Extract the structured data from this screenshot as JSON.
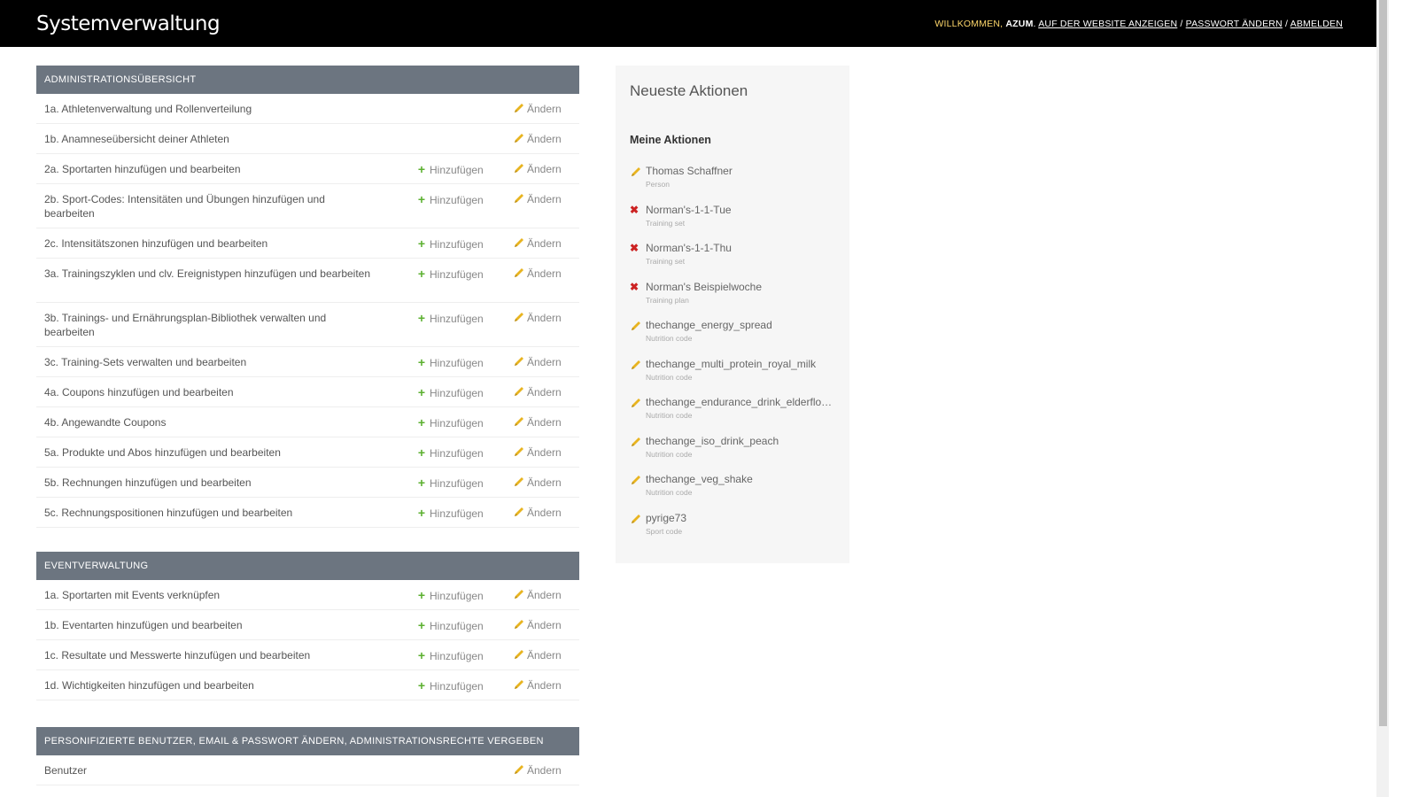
{
  "header": {
    "site_name": "Systemverwaltung",
    "welcome": "Willkommen,",
    "user": "azum",
    "links": [
      "Auf der Website anzeigen",
      "Passwort ändern",
      "Abmelden"
    ]
  },
  "labels": {
    "add": "Hinzufügen",
    "change": "Ändern"
  },
  "modules": [
    {
      "caption": "Administrationsübersicht",
      "rows": [
        {
          "label": "1a. Athletenverwaltung und Rollenverteilung",
          "add": false
        },
        {
          "label": "1b. Anamneseübersicht deiner Athleten",
          "add": false
        },
        {
          "label": "2a. Sportarten hinzufügen und bearbeiten",
          "add": true
        },
        {
          "label": "2b. Sport-Codes: Intensitäten und Übungen hinzufügen und bearbeiten",
          "add": true
        },
        {
          "label": "2c. Intensitätszonen hinzufügen und bearbeiten",
          "add": true
        },
        {
          "label": "3a. Trainingszyklen und clv. Ereignistypen hinzufügen und bearbeiten",
          "add": true
        },
        {
          "label": "3b. Trainings- und Ernährungsplan-Bibliothek verwalten und bearbeiten",
          "add": true
        },
        {
          "label": "3c. Training-Sets verwalten und bearbeiten",
          "add": true
        },
        {
          "label": "4a. Coupons hinzufügen und bearbeiten",
          "add": true
        },
        {
          "label": "4b. Angewandte Coupons",
          "add": true
        },
        {
          "label": "5a. Produkte und Abos hinzufügen und bearbeiten",
          "add": true
        },
        {
          "label": "5b. Rechnungen hinzufügen und bearbeiten",
          "add": true
        },
        {
          "label": "5c. Rechnungspositionen hinzufügen und bearbeiten",
          "add": true
        }
      ]
    },
    {
      "caption": "Eventverwaltung",
      "rows": [
        {
          "label": "1a. Sportarten mit Events verknüpfen",
          "add": true
        },
        {
          "label": "1b. Eventarten hinzufügen und bearbeiten",
          "add": true
        },
        {
          "label": "1c. Resultate und Messwerte hinzufügen und bearbeiten",
          "add": true
        },
        {
          "label": "1d. Wichtigkeiten hinzufügen und bearbeiten",
          "add": true
        }
      ]
    },
    {
      "caption": "Personifizierte Benutzer, Email & Passwort ändern, Administrationsrechte vergeben",
      "rows": [
        {
          "label": "Benutzer",
          "add": false
        }
      ]
    }
  ],
  "recent": {
    "title": "Neueste Aktionen",
    "subtitle": "Meine Aktionen",
    "items": [
      {
        "action": "change",
        "name": "Thomas Schaffner",
        "type": "Person"
      },
      {
        "action": "delete",
        "name": "Norman's-1-1-Tue",
        "type": "Training set"
      },
      {
        "action": "delete",
        "name": "Norman's-1-1-Thu",
        "type": "Training set"
      },
      {
        "action": "delete",
        "name": "Norman's Beispielwoche",
        "type": "Training plan"
      },
      {
        "action": "change",
        "name": "thechange_energy_spread",
        "type": "Nutrition code"
      },
      {
        "action": "change",
        "name": "thechange_multi_protein_royal_milk",
        "type": "Nutrition code"
      },
      {
        "action": "change",
        "name": "thechange_endurance_drink_elderflower",
        "type": "Nutrition code"
      },
      {
        "action": "change",
        "name": "thechange_iso_drink_peach",
        "type": "Nutrition code"
      },
      {
        "action": "change",
        "name": "thechange_veg_shake",
        "type": "Nutrition code"
      },
      {
        "action": "change",
        "name": "pyrige73",
        "type": "Sport code"
      }
    ]
  },
  "colors": {
    "header": "#000000",
    "caption": "#6c7580",
    "add_icon": "#5cb030",
    "change_icon": "#e8b420",
    "delete_icon": "#cc2222"
  }
}
